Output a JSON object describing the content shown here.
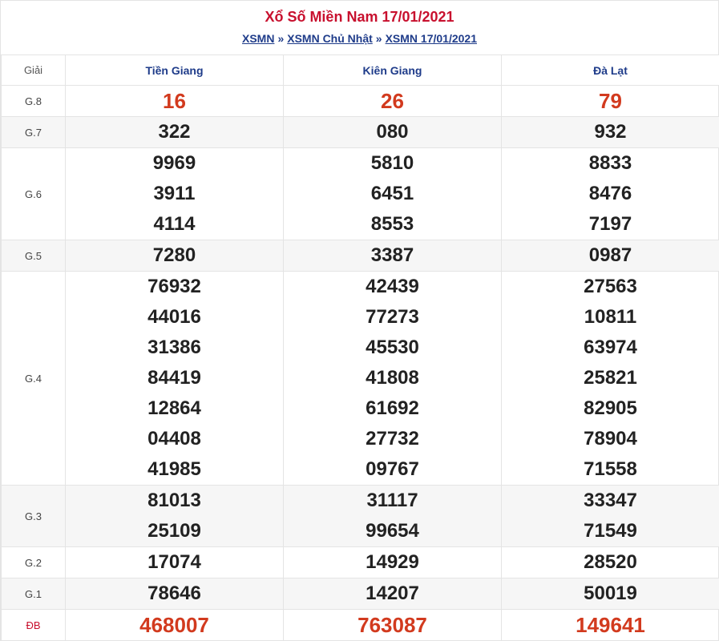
{
  "header": {
    "title": "Xổ Số Miền Nam 17/01/2021",
    "breadcrumb": [
      {
        "label": "XSMN"
      },
      {
        "label": "XSMN Chủ Nhật"
      },
      {
        "label": "XSMN 17/01/2021"
      }
    ],
    "separator": "»"
  },
  "table": {
    "label_header": "Giải",
    "provinces": [
      "Tiền Giang",
      "Kiên Giang",
      "Đà Lạt"
    ],
    "rows": [
      {
        "label": "G.8",
        "alt": false,
        "red": true,
        "values": [
          [
            "16"
          ],
          [
            "26"
          ],
          [
            "79"
          ]
        ]
      },
      {
        "label": "G.7",
        "alt": true,
        "red": false,
        "values": [
          [
            "322"
          ],
          [
            "080"
          ],
          [
            "932"
          ]
        ]
      },
      {
        "label": "G.6",
        "alt": false,
        "red": false,
        "values": [
          [
            "9969",
            "3911",
            "4114"
          ],
          [
            "5810",
            "6451",
            "8553"
          ],
          [
            "8833",
            "8476",
            "7197"
          ]
        ]
      },
      {
        "label": "G.5",
        "alt": true,
        "red": false,
        "values": [
          [
            "7280"
          ],
          [
            "3387"
          ],
          [
            "0987"
          ]
        ]
      },
      {
        "label": "G.4",
        "alt": false,
        "red": false,
        "values": [
          [
            "76932",
            "44016",
            "31386",
            "84419",
            "12864",
            "04408",
            "41985"
          ],
          [
            "42439",
            "77273",
            "45530",
            "41808",
            "61692",
            "27732",
            "09767"
          ],
          [
            "27563",
            "10811",
            "63974",
            "25821",
            "82905",
            "78904",
            "71558"
          ]
        ]
      },
      {
        "label": "G.3",
        "alt": true,
        "red": false,
        "values": [
          [
            "81013",
            "25109"
          ],
          [
            "31117",
            "99654"
          ],
          [
            "33347",
            "71549"
          ]
        ]
      },
      {
        "label": "G.2",
        "alt": false,
        "red": false,
        "values": [
          [
            "17074"
          ],
          [
            "14929"
          ],
          [
            "28520"
          ]
        ]
      },
      {
        "label": "G.1",
        "alt": true,
        "red": false,
        "values": [
          [
            "78646"
          ],
          [
            "14207"
          ],
          [
            "50019"
          ]
        ]
      },
      {
        "label": "ĐB",
        "alt": false,
        "red": true,
        "label_red": true,
        "values": [
          [
            "468007"
          ],
          [
            "763087"
          ],
          [
            "149641"
          ]
        ]
      }
    ]
  },
  "colors": {
    "title": "#c8102e",
    "link": "#1f3c8a",
    "prize_red": "#d23a1e",
    "alt_row": "#f6f6f6",
    "border": "#e4e4e4"
  }
}
